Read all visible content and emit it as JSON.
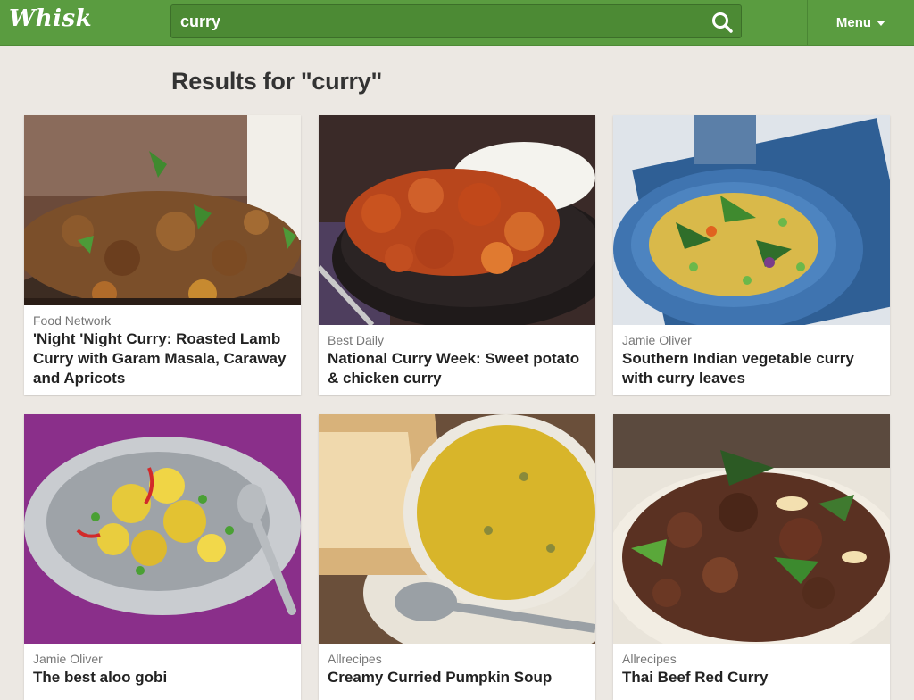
{
  "header": {
    "logo": "Whisk",
    "search_value": "curry",
    "search_icon": "search-icon",
    "menu_label": "Menu",
    "menu_icon": "caret-down-icon"
  },
  "results_heading": "Results for \"curry\"",
  "colors": {
    "brand_green": "#5a9c40",
    "search_bg": "#4c8a34",
    "page_bg": "#ece8e3"
  },
  "results": [
    {
      "source": "Food Network",
      "title": "'Night 'Night Curry: Roasted Lamb Curry with Garam Masala, Caraway and Apricots"
    },
    {
      "source": "Best Daily",
      "title": "National Curry Week: Sweet potato & chicken curry"
    },
    {
      "source": "Jamie Oliver",
      "title": "Southern Indian vegetable curry with curry leaves"
    },
    {
      "source": "Jamie Oliver",
      "title": "The best aloo gobi"
    },
    {
      "source": "Allrecipes",
      "title": "Creamy Curried Pumpkin Soup"
    },
    {
      "source": "Allrecipes",
      "title": "Thai Beef Red Curry"
    }
  ]
}
